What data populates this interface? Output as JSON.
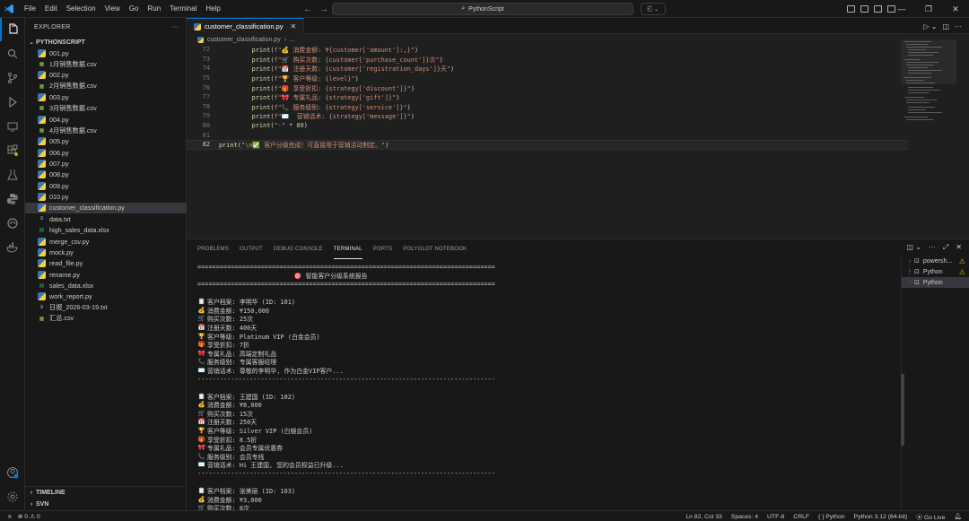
{
  "titlebar": {
    "menu": [
      "File",
      "Edit",
      "Selection",
      "View",
      "Go",
      "Run",
      "Terminal",
      "Help"
    ],
    "search": "PythonScript"
  },
  "sidebar": {
    "title": "EXPLORER",
    "root": "PYTHONSCRIPT",
    "files": [
      {
        "name": "001.py",
        "type": "py"
      },
      {
        "name": "1月销售数据.csv",
        "type": "csv"
      },
      {
        "name": "002.py",
        "type": "py"
      },
      {
        "name": "2月销售数据.csv",
        "type": "csv"
      },
      {
        "name": "003.py",
        "type": "py"
      },
      {
        "name": "3月销售数据.csv",
        "type": "csv"
      },
      {
        "name": "004.py",
        "type": "py"
      },
      {
        "name": "4月销售数据.csv",
        "type": "csv"
      },
      {
        "name": "005.py",
        "type": "py"
      },
      {
        "name": "006.py",
        "type": "py"
      },
      {
        "name": "007.py",
        "type": "py"
      },
      {
        "name": "008.py",
        "type": "py"
      },
      {
        "name": "009.py",
        "type": "py"
      },
      {
        "name": "010.py",
        "type": "py"
      },
      {
        "name": "customer_classification.py",
        "type": "py",
        "selected": true
      },
      {
        "name": "data.txt",
        "type": "txt"
      },
      {
        "name": "high_sales_data.xlsx",
        "type": "xlsx"
      },
      {
        "name": "merge_csv.py",
        "type": "py"
      },
      {
        "name": "mock.py",
        "type": "py"
      },
      {
        "name": "read_file.py",
        "type": "py"
      },
      {
        "name": "rename.py",
        "type": "py"
      },
      {
        "name": "sales_data.xlsx",
        "type": "xlsx"
      },
      {
        "name": "work_report.py",
        "type": "py"
      },
      {
        "name": "日报_2026-03-19.txt",
        "type": "txt"
      },
      {
        "name": "汇总.csv",
        "type": "csv"
      }
    ],
    "timeline": "TIMELINE",
    "svn": "SVN"
  },
  "editor": {
    "tab": "customer_classification.py",
    "breadcrumb": [
      "customer_classification.py",
      "..."
    ],
    "lines": [
      {
        "num": "72",
        "text": "    print(f\"💰 消费金额: ¥{customer['amount']:,}\")"
      },
      {
        "num": "73",
        "text": "    print(f\"🛒 购买次数: {customer['purchase_count']}次\")"
      },
      {
        "num": "74",
        "text": "    print(f\"📅 注册天数: {customer['registration_days']}天\")"
      },
      {
        "num": "75",
        "text": "    print(f\"🏆 客户等级: {level}\")"
      },
      {
        "num": "76",
        "text": "    print(f\"🎁 享受折扣: {strategy['discount']}\")"
      },
      {
        "num": "77",
        "text": "    print(f\"🎀 专属礼品: {strategy['gift']}\")"
      },
      {
        "num": "78",
        "text": "    print(f\"📞 服务级别: {strategy['service']}\")"
      },
      {
        "num": "79",
        "text": "    print(f\"✉️  营销话术: {strategy['message']}\")"
      },
      {
        "num": "80",
        "text": "    print(\"-\" * 80)"
      },
      {
        "num": "81",
        "text": ""
      },
      {
        "num": "82",
        "text": "print(\"\\n✅ 客户分级完成！可直接用于营销活动制定。\")",
        "current": true
      }
    ]
  },
  "panel": {
    "tabs": [
      "PROBLEMS",
      "OUTPUT",
      "DEBUG CONSOLE",
      "TERMINAL",
      "PORTS",
      "POLYGLOT NOTEBOOK"
    ],
    "active_tab": "TERMINAL",
    "terminal_lines": [
      {
        "icon": "",
        "text": "================================================================================"
      },
      {
        "icon": "",
        "text": "                          🎯 智能客户分级系统报告"
      },
      {
        "icon": "",
        "text": "================================================================================"
      },
      {
        "icon": "",
        "text": ""
      },
      {
        "icon": "📋",
        "text": "客户档案: 李明华 (ID: 101)"
      },
      {
        "icon": "💰",
        "text": "消费金额: ¥150,000"
      },
      {
        "icon": "🛒",
        "text": "购买次数: 25次"
      },
      {
        "icon": "📅",
        "text": "注册天数: 400天"
      },
      {
        "icon": "🏆",
        "text": "客户等级: Platinum VIP (白金会员)"
      },
      {
        "icon": "🎁",
        "text": "享受折扣: 7折"
      },
      {
        "icon": "🎀",
        "text": "专属礼品: 高端定制礼品"
      },
      {
        "icon": "📞",
        "text": "服务级别: 专属客服经理"
      },
      {
        "icon": "✉️",
        "text": "营销话术: 尊敬的李明华, 作为白金VIP客户..."
      },
      {
        "icon": "",
        "text": "--------------------------------------------------------------------------------"
      },
      {
        "icon": "",
        "text": ""
      },
      {
        "icon": "📋",
        "text": "客户档案: 王建国 (ID: 102)"
      },
      {
        "icon": "💰",
        "text": "消费金额: ¥8,000"
      },
      {
        "icon": "🛒",
        "text": "购买次数: 15次"
      },
      {
        "icon": "📅",
        "text": "注册天数: 250天"
      },
      {
        "icon": "🏆",
        "text": "客户等级: Silver VIP (白银会员)"
      },
      {
        "icon": "🎁",
        "text": "享受折扣: 8.5折"
      },
      {
        "icon": "🎀",
        "text": "专属礼品: 会员专属优惠券"
      },
      {
        "icon": "📞",
        "text": "服务级别: 会员专线"
      },
      {
        "icon": "✉️",
        "text": "营销话术: Hi 王建国, 您的会员权益已升级..."
      },
      {
        "icon": "",
        "text": "--------------------------------------------------------------------------------"
      },
      {
        "icon": "",
        "text": ""
      },
      {
        "icon": "📋",
        "text": "客户档案: 张美丽 (ID: 103)"
      },
      {
        "icon": "💰",
        "text": "消费金额: ¥3,000"
      },
      {
        "icon": "🛒",
        "text": "购买次数: 8次"
      }
    ],
    "terminals": [
      {
        "name": "powersh...",
        "warn": true
      },
      {
        "name": "Python",
        "warn": true
      },
      {
        "name": "Python",
        "warn": false,
        "selected": true
      }
    ]
  },
  "statusbar": {
    "errors": "0",
    "warnings": "0",
    "position": "Ln 82, Col 33",
    "spaces": "Spaces: 4",
    "encoding": "UTF-8",
    "eol": "CRLF",
    "language": "Python",
    "interpreter": "Python 3.12 (64-bit)",
    "golive": "Go Live"
  },
  "colors": {
    "accent": "#0078d4",
    "warning": "#cca700"
  }
}
